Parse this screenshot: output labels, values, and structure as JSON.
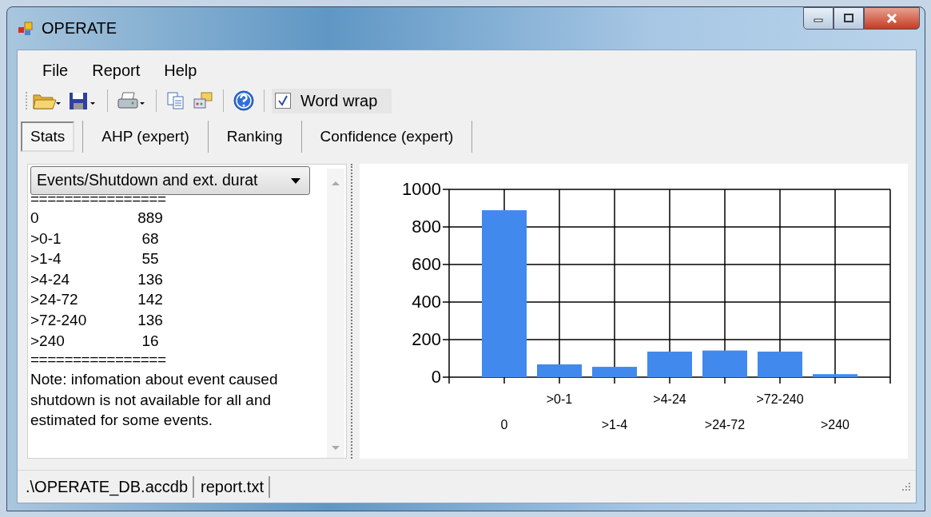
{
  "window": {
    "title": "OPERATE"
  },
  "menu": [
    "File",
    "Report",
    "Help"
  ],
  "toolbar": {
    "word_wrap": {
      "label": "Word wrap",
      "checked": true
    }
  },
  "tabs": [
    {
      "label": "Stats",
      "selected": true
    },
    {
      "label": "AHP (expert)",
      "selected": false
    },
    {
      "label": "Ranking",
      "selected": false
    },
    {
      "label": "Confidence (expert)",
      "selected": false
    }
  ],
  "report": {
    "dropdown": "Events/Shutdown and ext. durat",
    "separator_top": "================",
    "rows": [
      {
        "label": "0",
        "value": "889"
      },
      {
        "label": ">0-1",
        "value": "68"
      },
      {
        "label": ">1-4",
        "value": "55"
      },
      {
        "label": ">4-24",
        "value": "136"
      },
      {
        "label": ">24-72",
        "value": "142"
      },
      {
        "label": ">72-240",
        "value": "136"
      },
      {
        "label": ">240",
        "value": "16"
      }
    ],
    "separator_bottom": "================",
    "note": "Note: infomation about event caused shutdown is not available for all and estimated for some events."
  },
  "chart": {
    "chart_data": {
      "type": "bar",
      "categories": [
        "0",
        ">0-1",
        ">1-4",
        ">4-24",
        ">24-72",
        ">72-240",
        ">240"
      ],
      "grid": true,
      "series": [
        {
          "color": "#4189ec",
          "values": [
            889,
            68,
            55,
            136,
            142,
            136,
            16
          ]
        }
      ],
      "ylim": [
        0,
        1000
      ],
      "yticks": [
        0,
        200,
        400,
        600,
        800,
        1000
      ]
    }
  },
  "status_bar": [
    ".\\OPERATE_DB.accdb",
    "report.txt"
  ]
}
